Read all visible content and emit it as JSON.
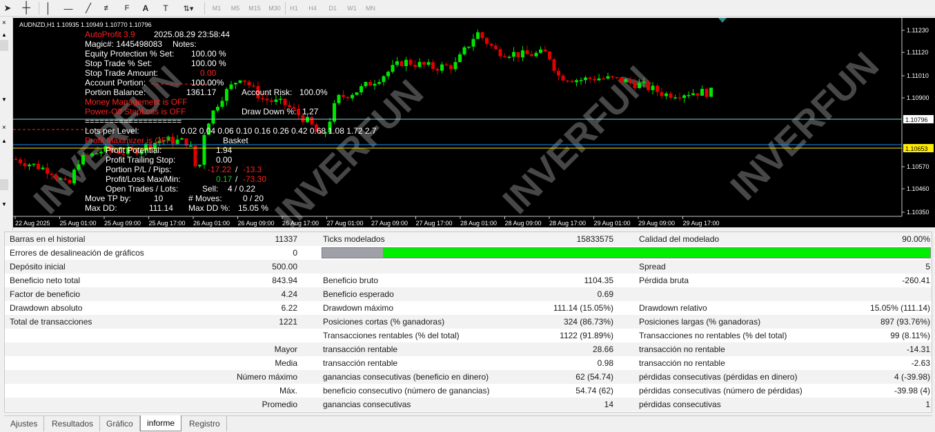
{
  "toolbar": {
    "timeframes": [
      "M1",
      "M5",
      "M15",
      "M30",
      "H1",
      "H4",
      "D1",
      "W1",
      "MN"
    ]
  },
  "chart": {
    "symbol_line": "AUDNZD,H1  1.10935 1.10949 1.10770 1.10796",
    "colors": {
      "bg": "#000000",
      "bull": "#00e600",
      "bear": "#e00000",
      "grid": "#3a3a3a",
      "text": "#ffffff",
      "red": "#ff2020",
      "green": "#22c22c",
      "bid": "#7fdbdb",
      "yellow": "#ffee00",
      "blue": "#1e90ff"
    },
    "price_labels": [
      "1.11230",
      "1.11120",
      "1.11010",
      "1.10900",
      "1.10796",
      "1.10653",
      "1.10570",
      "1.10460",
      "1.10350"
    ],
    "date_labels": [
      "22 Aug 2025",
      "25 Aug 01:00",
      "25 Aug 09:00",
      "25 Aug 17:00",
      "26 Aug 01:00",
      "26 Aug 09:00",
      "26 Aug 17:00",
      "27 Aug 01:00",
      "27 Aug 09:00",
      "27 Aug 17:00",
      "28 Aug 01:00",
      "28 Aug 09:00",
      "28 Aug 17:00",
      "29 Aug 01:00",
      "29 Aug 09:00",
      "29 Aug 17:00"
    ],
    "watermark": "INVERFUN",
    "overlay": {
      "ea_name": "AutoProfit 3.9",
      "datetime": "2025.08.29 23:58:44",
      "magic": "Magic#: 1445498083",
      "notes": "Notes:",
      "equity_protection_label": "Equity Protection % Set:",
      "equity_protection_value": "100.00 %",
      "stop_trade_pct_label": "Stop Trade % Set:",
      "stop_trade_pct_value": "100.00 %",
      "stop_trade_amount_label": "Stop Trade Amount:",
      "stop_trade_amount_value": "0.00",
      "account_portion_label": "Account Portion:",
      "account_portion_value": "100.00%",
      "portion_balance_label": "Portion Balance:",
      "portion_balance_value": "1361.17",
      "account_risk_label": "Account Risk:",
      "account_risk_value": "100.0%",
      "money_mgmt": "Money Management is OFF",
      "power_off": "Power-Off StopLoss is OFF",
      "drawdown_label": "Draw Down %:",
      "drawdown_value": "1.27",
      "separator": "====================",
      "lots_label": "Lots per Level:",
      "lots_values": "0.02  0.04  0.06  0.10  0.16  0.26  0.42  0.68  1.08  1.72  2.7",
      "profit_max": "Profit Maximizer is OFF",
      "basket": "Basket",
      "profit_potential_label": "Profit Potential:",
      "profit_potential_value": "1.94",
      "profit_trailing_label": "Profit Trailing Stop:",
      "profit_trailing_value": "0.00",
      "portion_pl_label": "Portion P/L / Pips:",
      "portion_pl_value": "-17.22",
      "portion_pips_value": "-13.3",
      "pl_maxmin_label": "Profit/Loss Max/Min:",
      "pl_max_value": "0.17",
      "pl_min_value": "-73.30",
      "open_trades_label": "Open Trades / Lots:",
      "open_trades_side": "Sell:",
      "open_trades_value": "4  /  0.22",
      "move_tp_label": "Move TP by:",
      "move_tp_value": "10",
      "moves_label": "# Moves:",
      "moves_value": "0  /  20",
      "max_dd_label": "Max DD:",
      "max_dd_value": "111.14",
      "max_dd_pct_label": "Max DD %:",
      "max_dd_pct_value": "15.05 %",
      "slash": "/"
    }
  },
  "report": {
    "rows": [
      {
        "l": "Barras en el historial",
        "lv": "11337",
        "m": "Ticks modelados",
        "mv": "15833575",
        "rl": "Calidad del modelado",
        "rv": "90.00%"
      },
      {
        "l": "Errores de desalineación de gráficos",
        "lv": "0"
      },
      {
        "l": "Depósito inicial",
        "lv": "500.00",
        "rl": "Spread",
        "rv": "5"
      },
      {
        "l": "Beneficio neto total",
        "lv": "843.94",
        "m": "Beneficio bruto",
        "mv": "1104.35",
        "rl": "Pérdida bruta",
        "rv": "-260.41"
      },
      {
        "l": "Factor de beneficio",
        "lv": "4.24",
        "m": "Beneficio esperado",
        "mv": "0.69"
      },
      {
        "l": "Drawdown absoluto",
        "lv": "6.22",
        "m": "Drawdown máximo",
        "mv": "111.14 (15.05%)",
        "rl": "Drawdown relativo",
        "rv": "15.05% (111.14)"
      },
      {
        "l": "Total de transacciones",
        "lv": "1221",
        "m": "Posiciones cortas (% ganadoras)",
        "mv": "324 (86.73%)",
        "rl": "Posiciones largas (% ganadoras)",
        "rv": "897 (93.76%)"
      },
      {
        "m": "Transacciones rentables (% del total)",
        "mv": "1122 (91.89%)",
        "rl": "Transacciones no rentables (% del total)",
        "rv": "99 (8.11%)"
      },
      {
        "lv": "Mayor",
        "m": "transacción rentable",
        "mv": "28.66",
        "rl": "transacción no rentable",
        "rv": "-14.31"
      },
      {
        "lv": "Media",
        "m": "transacción rentable",
        "mv": "0.98",
        "rl": "transacción no rentable",
        "rv": "-2.63"
      },
      {
        "lv": "Número máximo",
        "m": "ganancias consecutivas (beneficio en dinero)",
        "mv": "62 (54.74)",
        "rl": "pérdidas consecutivas (pérdidas en dinero)",
        "rv": "4 (-39.98)"
      },
      {
        "lv": "Máx.",
        "m": "beneficio consecutivo (número de ganancias)",
        "mv": "54.74 (62)",
        "rl": "pérdidas consecutivas (número de pérdidas)",
        "rv": "-39.98 (4)"
      },
      {
        "lv": "Promedio",
        "m": "ganancias consecutivas",
        "mv": "14",
        "rl": "pérdidas consecutivas",
        "rv": "1"
      }
    ],
    "modeling_quality_fraction": 0.9,
    "quality_colors": {
      "gray": "#a0a0a8",
      "green": "#00ee00"
    }
  },
  "tabs": [
    "Ajustes",
    "Resultados",
    "Gráfico",
    "informe",
    "Registro"
  ],
  "active_tab": "informe"
}
